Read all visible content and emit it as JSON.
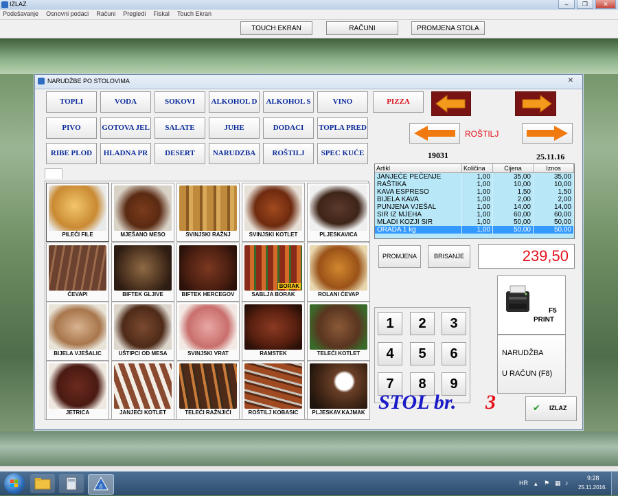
{
  "app": {
    "title": "IZLAZ"
  },
  "menu": [
    "Podešavanje",
    "Osnovni podaci",
    "Računi",
    "Pregledi",
    "Fiskal",
    "Touch Ekran"
  ],
  "toolbar": {
    "touch": "TOUCH  EKRAN",
    "racuni": "RAČUNI",
    "promjena_stola": "PROMJENA STOLA"
  },
  "dialog": {
    "title": "NARUDŽBE PO STOLOVIMA"
  },
  "categories": [
    "TOPLI",
    "VODA",
    "SOKOVI",
    "ALKOHOL D",
    "ALKOHOL S",
    "VINO",
    "PIZZA",
    "PIVO",
    "GOTOVA JEL",
    "SALATE",
    "JUHE",
    "DODACI",
    "TOPLA PRED",
    "RIBE PLOD",
    "HLADNA PR",
    "DESERT",
    "NARUDZBA",
    "ROŠTILJ",
    "SPEC KUĆE"
  ],
  "current_category": "ROŠTILJ",
  "order_number": "19031",
  "date": "25.11.16",
  "products": [
    "PILEĆI FILE",
    "MJEŠANO MESO",
    "SVINJSKI RAŽNJ",
    "SVINJSKI KOTLET",
    "PLJESKAVICA",
    "ĆEVAPI",
    "BIFTEK GLJIVE",
    "BIFTEK HERCEGOV",
    "SABLJA BORAK",
    "ROLANI ĆEVAP",
    "BIJELA VJEŠALIC",
    "UŠTIPCI OD MESA",
    "SVINJSKI VRAT",
    "RAMSTEK",
    "TELEĆI KOTLET",
    "JETRICA",
    "JANJEĆI KOTLET",
    "TELEĆI RAŽNJIĆI",
    "ROŠTILJ KOBASIC",
    "PLJESKAV.KAJMAK"
  ],
  "product_overlay_text": "BORAK",
  "table_headers": [
    "Artikl",
    "Količina",
    "Cijena",
    "Iznos"
  ],
  "order_rows": [
    {
      "artikl": "JANJEĆE PEČENJE",
      "kolicina": "1,00",
      "cijena": "35,00",
      "iznos": "35,00"
    },
    {
      "artikl": "RAŠTIKA",
      "kolicina": "1,00",
      "cijena": "10,00",
      "iznos": "10,00"
    },
    {
      "artikl": "KAVA ESPRESO",
      "kolicina": "1,00",
      "cijena": "1,50",
      "iznos": "1,50"
    },
    {
      "artikl": "BIJELA KAVA",
      "kolicina": "1,00",
      "cijena": "2,00",
      "iznos": "2,00"
    },
    {
      "artikl": "PUNJENA VJEŠAL",
      "kolicina": "1,00",
      "cijena": "14,00",
      "iznos": "14,00"
    },
    {
      "artikl": "SIR IZ MJEHA",
      "kolicina": "1,00",
      "cijena": "60,00",
      "iznos": "60,00"
    },
    {
      "artikl": "MLADI KOZJI SIR",
      "kolicina": "1,00",
      "cijena": "50,00",
      "iznos": "50,00"
    },
    {
      "artikl": "ORADA 1 kg",
      "kolicina": "1,00",
      "cijena": "50,00",
      "iznos": "50,00"
    }
  ],
  "buttons": {
    "promjena": "PROMJENA",
    "brisanje": "BRISANJE",
    "print_f5": "F5",
    "print": "PRINT",
    "racun_line1": "NARUDŽBA",
    "racun_line2": "U RAČUN (F8)",
    "izlaz": "IZLAZ"
  },
  "total": "239,50",
  "keypad": [
    "1",
    "2",
    "3",
    "4",
    "5",
    "6",
    "7",
    "8",
    "9"
  ],
  "table": {
    "label": "STOL br.",
    "number": "3"
  },
  "taskbar": {
    "lang": "HR",
    "time": "9:28",
    "date": "25.11.2016."
  },
  "colors": {
    "category_text": "#0a2b9a",
    "pizza_text": "#d8101a",
    "arrow": "#f07a10",
    "total_text": "#e3101a",
    "selected_row": "#3399ff",
    "table_bg": "#b8e8f8",
    "stol_label": "#1a1ac8",
    "stol_number": "#e3101a"
  }
}
